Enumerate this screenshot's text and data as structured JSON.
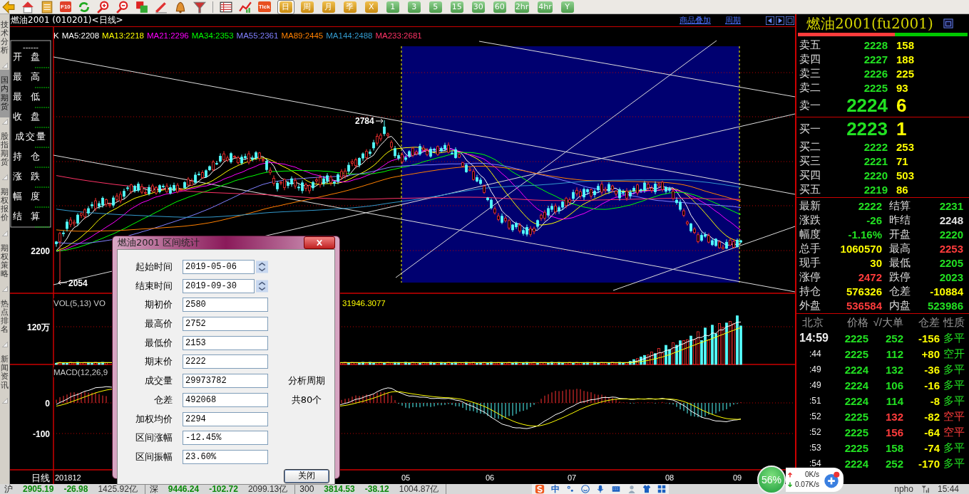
{
  "toolbar": {
    "f10_label": "F10",
    "tick_label": "Tick",
    "periods": [
      {
        "label": "日",
        "kind": "gold",
        "selected": true
      },
      {
        "label": "周",
        "kind": "gold",
        "selected": false
      },
      {
        "label": "月",
        "kind": "gold",
        "selected": false
      },
      {
        "label": "季",
        "kind": "gold",
        "selected": false
      },
      {
        "label": "X",
        "kind": "gold",
        "selected": false
      },
      {
        "label": "1",
        "kind": "green",
        "selected": false
      },
      {
        "label": "3",
        "kind": "green",
        "selected": false
      },
      {
        "label": "5",
        "kind": "green",
        "selected": false
      },
      {
        "label": "15",
        "kind": "green",
        "selected": false
      },
      {
        "label": "30",
        "kind": "green",
        "selected": false
      },
      {
        "label": "60",
        "kind": "green",
        "selected": false
      },
      {
        "label": "2hr",
        "kind": "green",
        "selected": false
      },
      {
        "label": "4hr",
        "kind": "green",
        "selected": false
      },
      {
        "label": "Y",
        "kind": "green",
        "selected": false
      }
    ]
  },
  "side_tabs": [
    {
      "label": "技术分析",
      "selected": false
    },
    {
      "label": "国内期货",
      "selected": true
    },
    {
      "label": "股指期货",
      "selected": false
    },
    {
      "label": "期权报价",
      "selected": false
    },
    {
      "label": "期权策略",
      "selected": false
    },
    {
      "label": "热点排名",
      "selected": false
    },
    {
      "label": "新闻资讯",
      "selected": false
    }
  ],
  "chart": {
    "title": "燃油2001 (010201)<日线>",
    "links": [
      "商品叠加",
      "周期"
    ],
    "ma_legend": [
      {
        "label": "K",
        "color": "#ffffff"
      },
      {
        "label": "MA5:2208",
        "color": "#ffffff"
      },
      {
        "label": "MA13:2218",
        "color": "#ffff00"
      },
      {
        "label": "MA21:2296",
        "color": "#ff00ff"
      },
      {
        "label": "MA34:2353",
        "color": "#00ff00"
      },
      {
        "label": "MA55:2361",
        "color": "#8080ff"
      },
      {
        "label": "MA89:2445",
        "color": "#ff8000"
      },
      {
        "label": "MA144:2488",
        "color": "#3399cc"
      },
      {
        "label": "MA233:2681",
        "color": "#ff3366"
      }
    ],
    "info_box": {
      "header": "------",
      "labels": [
        "开盘",
        "最高",
        "最低",
        "收盘",
        "成交量",
        "持仓",
        "涨跌",
        "幅度",
        "结算"
      ]
    },
    "peak_label": "2784",
    "low_label": "2054",
    "price_axis": "2200",
    "vol_legend": "VOL(5,13) VO",
    "vol_value": "31946.3077",
    "vol_axis": "120万",
    "macd_legend": "MACD(12,26,9",
    "macd_axis": [
      "0",
      "-100"
    ],
    "x_axis": {
      "period": "日线",
      "labels": [
        "201812",
        "05",
        "06",
        "07",
        "08",
        "09"
      ]
    }
  },
  "dialog": {
    "title": "燃油2001 区间统计",
    "fields": [
      {
        "label": "起始时间",
        "value": "2019-05-06",
        "kind": "spin"
      },
      {
        "label": "结束时间",
        "value": "2019-09-30",
        "kind": "spin"
      },
      {
        "label": "期初价",
        "value": "2580",
        "kind": "text"
      },
      {
        "label": "最高价",
        "value": "2752",
        "kind": "text"
      },
      {
        "label": "最低价",
        "value": "2153",
        "kind": "text"
      },
      {
        "label": "期末价",
        "value": "2222",
        "kind": "text"
      },
      {
        "label": "成交量",
        "value": "29973782",
        "kind": "text"
      },
      {
        "label": "仓差",
        "value": "492068",
        "kind": "text"
      },
      {
        "label": "加权均价",
        "value": "2294",
        "kind": "text"
      },
      {
        "label": "区间涨幅",
        "value": "-12.45%",
        "kind": "text"
      },
      {
        "label": "区间振幅",
        "value": "23.60%",
        "kind": "text"
      }
    ],
    "notes": [
      "分析周期",
      "共80个"
    ],
    "button": "关闭"
  },
  "quote": {
    "title": "燃油2001(fu2001)",
    "ratio_bar": {
      "level": 0.57
    },
    "asks": [
      {
        "label": "卖五",
        "price": "2228",
        "volume": "158",
        "kind": "normal"
      },
      {
        "label": "卖四",
        "price": "2227",
        "volume": "188",
        "kind": "normal"
      },
      {
        "label": "卖三",
        "price": "2226",
        "volume": "225",
        "kind": "normal"
      },
      {
        "label": "卖二",
        "price": "2225",
        "volume": "93",
        "kind": "normal"
      },
      {
        "label": "卖一",
        "price": "2224",
        "volume": "6",
        "kind": "best"
      }
    ],
    "bids": [
      {
        "label": "买一",
        "price": "2223",
        "volume": "1",
        "kind": "best"
      },
      {
        "label": "买二",
        "price": "2222",
        "volume": "253",
        "kind": "normal"
      },
      {
        "label": "买三",
        "price": "2221",
        "volume": "71",
        "kind": "normal"
      },
      {
        "label": "买四",
        "price": "2220",
        "volume": "503",
        "kind": "normal"
      },
      {
        "label": "买五",
        "price": "2219",
        "volume": "86",
        "kind": "normal"
      }
    ],
    "stats": [
      {
        "label": "最新",
        "value": "2222",
        "color": "#22e022"
      },
      {
        "label": "结算",
        "value": "2231",
        "color": "#22e022"
      },
      {
        "label": "涨跌",
        "value": "-26",
        "color": "#22e022"
      },
      {
        "label": "昨结",
        "value": "2248",
        "color": "#e0e0e0"
      },
      {
        "label": "幅度",
        "value": "-1.16%",
        "color": "#22e022"
      },
      {
        "label": "开盘",
        "value": "2220",
        "color": "#22e022"
      },
      {
        "label": "总手",
        "value": "1060570",
        "color": "#ffff00"
      },
      {
        "label": "最高",
        "value": "2253",
        "color": "#ff3c3c"
      },
      {
        "label": "现手",
        "value": "30",
        "color": "#ffff00"
      },
      {
        "label": "最低",
        "value": "2205",
        "color": "#22e022"
      },
      {
        "label": "涨停",
        "value": "2472",
        "color": "#ff3c3c"
      },
      {
        "label": "跌停",
        "value": "2023",
        "color": "#22e022"
      },
      {
        "label": "持仓",
        "value": "576326",
        "color": "#ffff00"
      },
      {
        "label": "仓差",
        "value": "-10884",
        "color": "#ffff00"
      },
      {
        "label": "外盘",
        "value": "536584",
        "color": "#ff3c3c"
      },
      {
        "label": "内盘",
        "value": "523986",
        "color": "#22e022"
      }
    ],
    "ticks": {
      "columns": [
        "北京",
        "价格",
        "√/大单",
        "仓差",
        "性质"
      ],
      "rows": [
        {
          "time": "14:59",
          "kind": "full",
          "price": "2225",
          "volume": "252",
          "oi_change": "-156",
          "nature": "多平",
          "color": "#22e022"
        },
        {
          "time": ":44",
          "kind": "minute",
          "price": "2225",
          "volume": "112",
          "oi_change": "+80",
          "nature": "空开",
          "color": "#22e022"
        },
        {
          "time": ":49",
          "kind": "minute",
          "price": "2224",
          "volume": "132",
          "oi_change": "-36",
          "nature": "多平",
          "color": "#22e022"
        },
        {
          "time": ":49",
          "kind": "minute",
          "price": "2224",
          "volume": "106",
          "oi_change": "-16",
          "nature": "多平",
          "color": "#22e022"
        },
        {
          "time": ":51",
          "kind": "minute",
          "price": "2224",
          "volume": "114",
          "oi_change": "-8",
          "nature": "多平",
          "color": "#22e022"
        },
        {
          "time": ":52",
          "kind": "minute",
          "price": "2225",
          "volume": "132",
          "oi_change": "-82",
          "nature": "空平",
          "color": "#ff3c3c"
        },
        {
          "time": ":52",
          "kind": "minute",
          "price": "2225",
          "volume": "156",
          "oi_change": "-64",
          "nature": "空平",
          "color": "#ff3c3c"
        },
        {
          "time": ":53",
          "kind": "minute",
          "price": "2225",
          "volume": "158",
          "oi_change": "-74",
          "nature": "多平",
          "color": "#22e022"
        },
        {
          "time": ":54",
          "kind": "minute",
          "price": "2224",
          "volume": "252",
          "oi_change": "-170",
          "nature": "多平",
          "color": "#22e022"
        }
      ]
    }
  },
  "status_bar": {
    "indices": [
      {
        "name": "沪",
        "value": "2905.19",
        "change": "-26.98",
        "amount": "1425.92亿"
      },
      {
        "name": "深",
        "value": "9446.24",
        "change": "-102.72",
        "amount": "2099.13亿"
      },
      {
        "name": "300",
        "value": "3814.53",
        "change": "-38.12",
        "amount": "1004.87亿"
      }
    ]
  },
  "tray": {
    "ime": "中",
    "cpu": "56%",
    "upload": "0K/s",
    "download": "0.07K/s",
    "tray_text": "npho",
    "clock": "15:44"
  }
}
